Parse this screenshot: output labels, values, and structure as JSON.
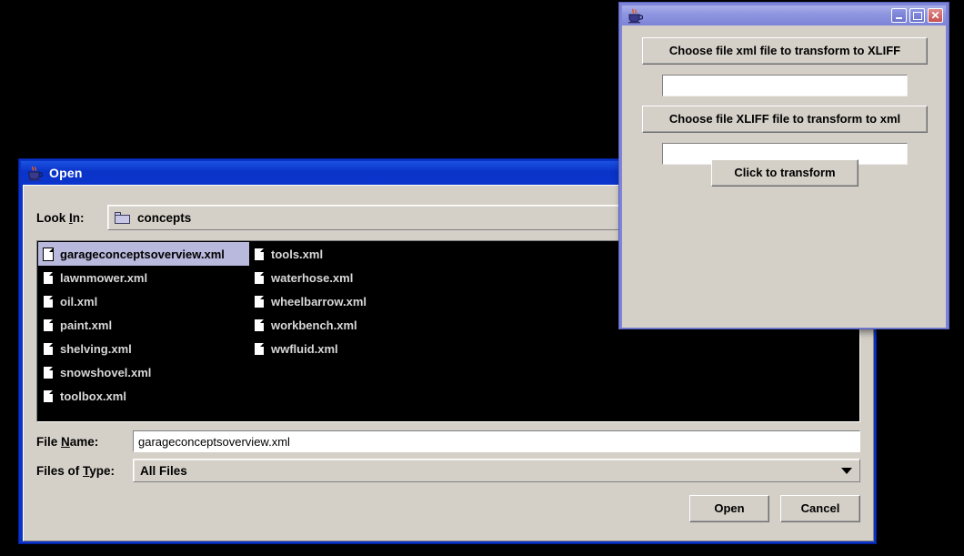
{
  "desktop": {
    "background_color": "#000000"
  },
  "java_window": {
    "icon": "java-coffee-cup-icon",
    "title": "",
    "window_controls": {
      "minimize": "minimize-icon",
      "maximize": "maximize-icon",
      "close": "close-icon"
    },
    "choose_xml_button": "Choose file xml file to transform to XLIFF",
    "xml_path_value": "",
    "xml_path_placeholder": "",
    "choose_xliff_button": "Choose file XLIFF file to transform to xml",
    "xliff_path_value": "",
    "xliff_path_placeholder": "",
    "transform_button": "Click to transform"
  },
  "open_dialog": {
    "icon": "java-coffee-cup-icon",
    "title": "Open",
    "look_in": {
      "label": "Look In:",
      "icon": "folder-icon",
      "value": "concepts"
    },
    "files": [
      {
        "name": "garageconceptsoverview.xml",
        "icon": "document-icon",
        "selected": true
      },
      {
        "name": "lawnmower.xml",
        "icon": "document-icon",
        "selected": false
      },
      {
        "name": "oil.xml",
        "icon": "document-icon",
        "selected": false
      },
      {
        "name": "paint.xml",
        "icon": "document-icon",
        "selected": false
      },
      {
        "name": "shelving.xml",
        "icon": "document-icon",
        "selected": false
      },
      {
        "name": "snowshovel.xml",
        "icon": "document-icon",
        "selected": false
      },
      {
        "name": "toolbox.xml",
        "icon": "document-icon",
        "selected": false
      },
      {
        "name": "tools.xml",
        "icon": "document-icon",
        "selected": false
      },
      {
        "name": "waterhose.xml",
        "icon": "document-icon",
        "selected": false
      },
      {
        "name": "wheelbarrow.xml",
        "icon": "document-icon",
        "selected": false
      },
      {
        "name": "workbench.xml",
        "icon": "document-icon",
        "selected": false
      },
      {
        "name": "wwfluid.xml",
        "icon": "document-icon",
        "selected": false
      }
    ],
    "file_name": {
      "label": "File Name:",
      "value": "garageconceptsoverview.xml"
    },
    "files_of_type": {
      "label": "Files of Type:",
      "value": "All Files",
      "caret": "chevron-down-icon"
    },
    "open_button": "Open",
    "cancel_button": "Cancel"
  },
  "colors": {
    "title_bar_blue": "#0a33c8",
    "java_title_purple": "#7d84d8",
    "metal_gray": "#d4d0c8",
    "selection_lavender": "#b9b9dd",
    "list_background": "#000000"
  }
}
